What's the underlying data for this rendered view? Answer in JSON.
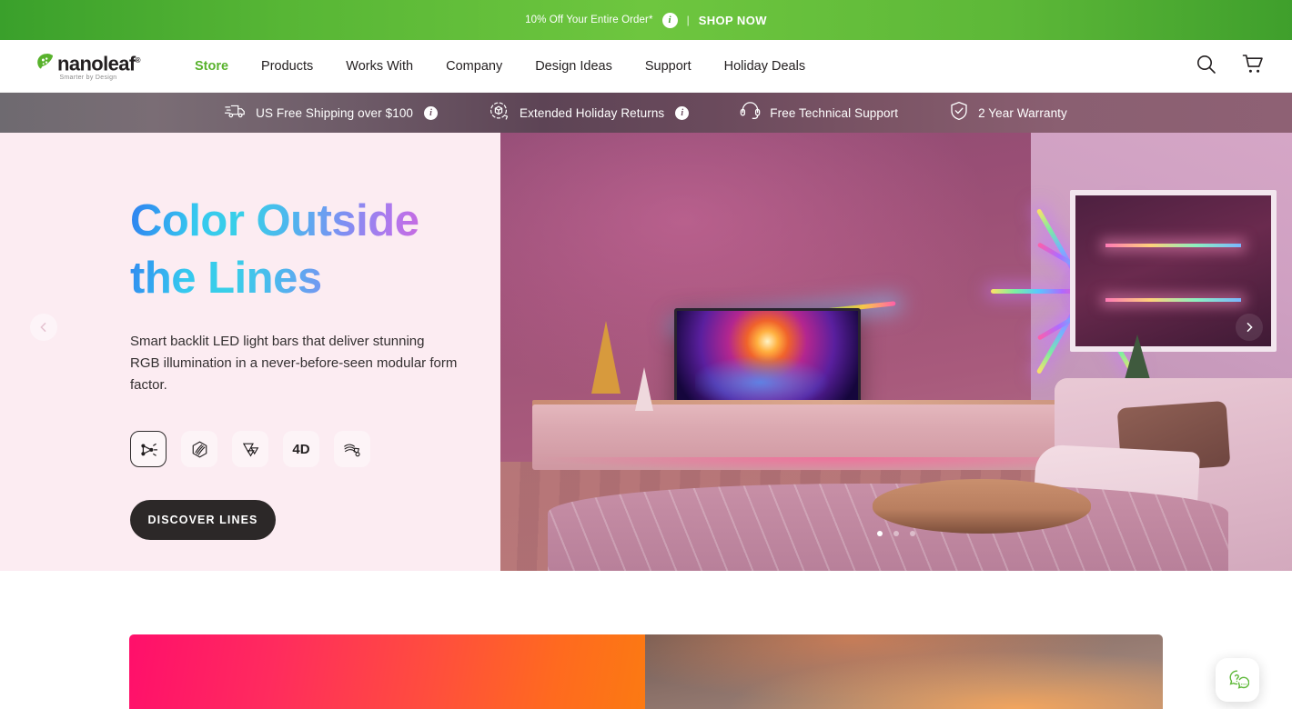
{
  "promo_bar": {
    "text": "10% Off Your Entire Order*",
    "info_icon": "info-icon",
    "separator": "|",
    "cta": "SHOP NOW",
    "background_color": "#5db838"
  },
  "header": {
    "logo": {
      "wordmark": "nanoleaf",
      "registered": "®",
      "tagline": "Smarter by Design",
      "mark_color": "#58b22c"
    },
    "nav": [
      {
        "label": "Store",
        "active": true
      },
      {
        "label": "Products",
        "active": false
      },
      {
        "label": "Works With",
        "active": false
      },
      {
        "label": "Company",
        "active": false
      },
      {
        "label": "Design Ideas",
        "active": false
      },
      {
        "label": "Support",
        "active": false
      },
      {
        "label": "Holiday Deals",
        "active": false
      }
    ],
    "active_color": "#58b22c",
    "icons": [
      {
        "name": "search-icon",
        "label": "Search"
      },
      {
        "name": "cart-icon",
        "label": "Cart"
      }
    ]
  },
  "value_bar": {
    "items": [
      {
        "icon": "truck-icon",
        "label": "US Free Shipping over $100",
        "has_info": true
      },
      {
        "icon": "box-return-icon",
        "label": "Extended Holiday Returns",
        "has_info": true
      },
      {
        "icon": "headset-icon",
        "label": "Free Technical Support",
        "has_info": false
      },
      {
        "icon": "shield-check-icon",
        "label": "2 Year Warranty",
        "has_info": false
      }
    ]
  },
  "hero": {
    "title_line1": "Color Outside",
    "title_line2": "the Lines",
    "description": "Smart backlit LED light bars that deliver stunning RGB illumination in a never-before-seen modular form factor.",
    "product_icons": [
      {
        "name": "lines-icon",
        "label": "Lines",
        "glyph": "",
        "selected": true
      },
      {
        "name": "elements-hexagon-icon",
        "label": "Elements",
        "glyph": "",
        "selected": false
      },
      {
        "name": "shapes-triangle-icon",
        "label": "Shapes",
        "glyph": "",
        "selected": false
      },
      {
        "name": "four-d-icon",
        "label": "4D",
        "glyph": "4D",
        "selected": false
      },
      {
        "name": "light-strip-icon",
        "label": "Light Strip",
        "glyph": "",
        "selected": false
      }
    ],
    "cta_label": "DISCOVER LINES",
    "prev_arrow": "‹",
    "next_arrow": "›",
    "carousel_dots": 3,
    "active_dot": 0,
    "title_gradient_start": "#36c8ef",
    "title_gradient_end": "#e455c9",
    "left_background": "#fcecf2"
  },
  "section2": {
    "gradient_start": "#ff0f6b",
    "gradient_end": "#fb7a12"
  },
  "chat_widget": {
    "name": "help-chat-icon",
    "color": "#5db838"
  }
}
